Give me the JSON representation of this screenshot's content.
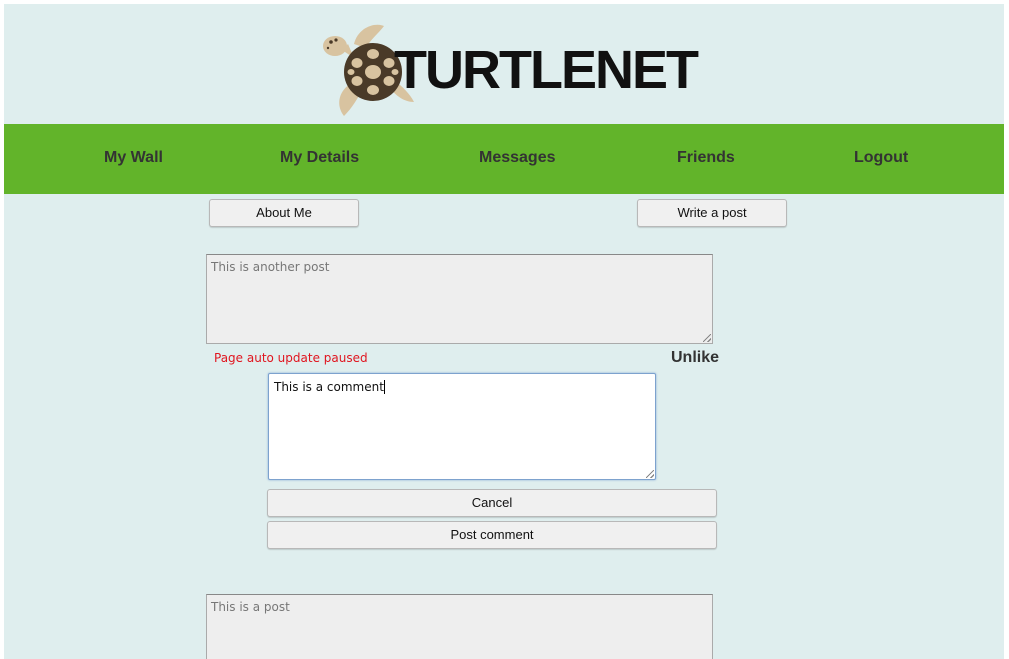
{
  "app": {
    "logo_text": "TURTLENET"
  },
  "nav": {
    "items": [
      {
        "label": "My Wall"
      },
      {
        "label": "My Details"
      },
      {
        "label": "Messages"
      },
      {
        "label": "Friends"
      },
      {
        "label": "Logout"
      }
    ]
  },
  "toolbar": {
    "about_label": "About Me",
    "write_post_label": "Write a post"
  },
  "posts": [
    {
      "text": "This is another post",
      "status": "Page auto update paused",
      "like_action": "Unlike",
      "comment_draft": "This is a comment",
      "cancel_label": "Cancel",
      "post_comment_label": "Post comment"
    },
    {
      "text": "This is a post"
    }
  ],
  "colors": {
    "background": "#dfeeee",
    "nav_bar": "#62b42a",
    "status_text": "#e0151f"
  },
  "icons": {
    "logo": "turtle-logo-icon"
  }
}
